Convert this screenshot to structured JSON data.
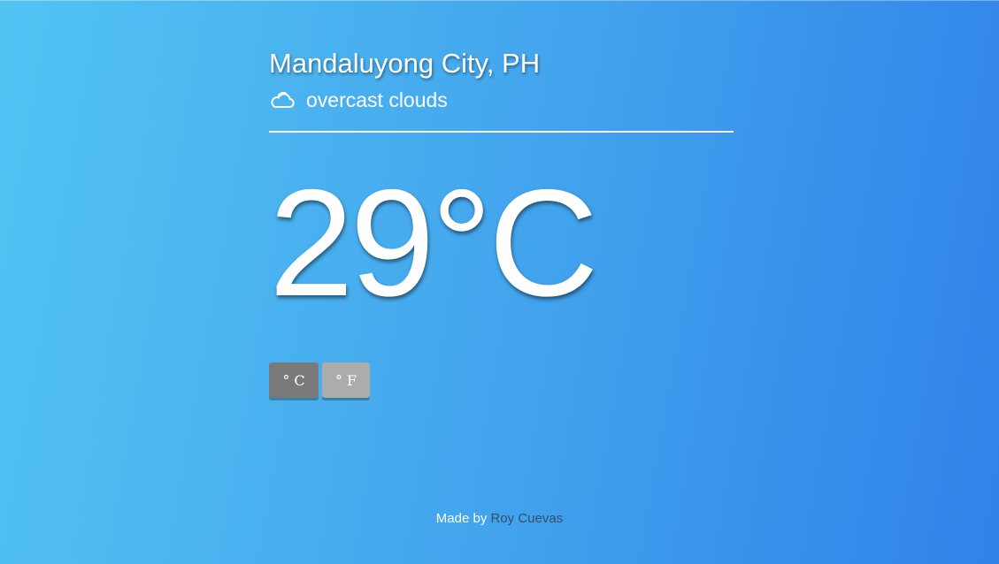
{
  "weather": {
    "location": "Mandaluyong City, PH",
    "condition_icon": "cloud-icon",
    "condition": "overcast clouds",
    "temperature": "29",
    "temperature_unit": "°C"
  },
  "units": {
    "celsius_label": "° C",
    "fahrenheit_label": "° F",
    "active": "celsius"
  },
  "footer": {
    "prefix": "Made by",
    "author": "Roy Cuevas"
  },
  "colors": {
    "gradient_start": "#52c4f3",
    "gradient_end": "#3082e8",
    "active_button": "#7a7a7a",
    "inactive_button": "#acacac",
    "author_link": "#3b4d63"
  }
}
